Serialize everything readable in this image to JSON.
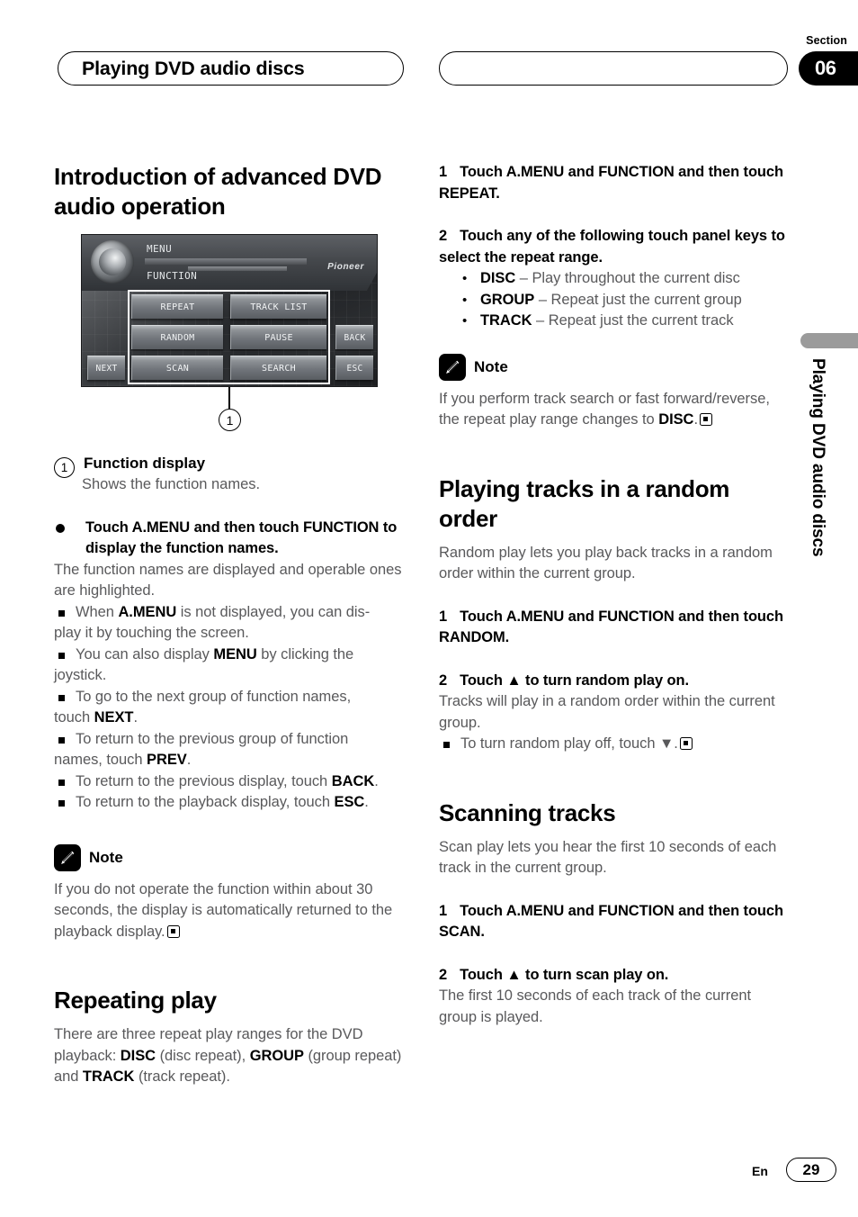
{
  "header": {
    "chapter_title": "Playing DVD audio discs",
    "section_label": "Section",
    "section_number": "06",
    "blank_pill": ""
  },
  "side_tab": {
    "vertical_title": "Playing DVD audio discs"
  },
  "left_column": {
    "heading": "Introduction of advanced DVD audio operation",
    "figure": {
      "device_menu_label": "MENU",
      "device_function_label": "FUNCTION",
      "device_brand": "Pioneer",
      "keys": [
        "REPEAT",
        "TRACK LIST",
        "RANDOM",
        "PAUSE",
        "SCAN",
        "SEARCH",
        "BACK",
        "ESC",
        "NEXT"
      ],
      "callout_number": "1"
    },
    "caption": {
      "number": "1",
      "title": "Function display",
      "subtitle": "Shows the function names."
    },
    "bullet_step": "Touch A.MENU and then touch FUNCTION to display the function names.",
    "bullet_step_body": "The function names are displayed and operable ones are highlighted.",
    "sub_items": [
      "When A.MENU is not displayed, you can display it by touching the screen.",
      "You can also display MENU by clicking the joystick.",
      "To go to the next group of function names, touch NEXT.",
      "To return to the previous group of function names, touch PREV.",
      "To return to the previous display, touch BACK.",
      "To return to the playback display, touch ESC."
    ],
    "note": {
      "label": "Note",
      "text": "If you do not operate the function within about 30 seconds, the display is automatically returned to the playback display."
    },
    "repeating_play": {
      "heading": "Repeating play",
      "body": "There are three repeat play ranges for the DVD playback: DISC (disc repeat), GROUP (group repeat) and TRACK (track repeat)."
    }
  },
  "right_column": {
    "repeat_steps": [
      {
        "num": "1",
        "text": "Touch A.MENU and FUNCTION and then touch REPEAT."
      },
      {
        "num": "2",
        "text": "Touch any of the following touch panel keys to select the repeat range."
      }
    ],
    "repeat_ranges": [
      {
        "key": "DISC",
        "desc": "– Play throughout the current disc"
      },
      {
        "key": "GROUP",
        "desc": "– Repeat just the current group"
      },
      {
        "key": "TRACK",
        "desc": "– Repeat just the current track"
      }
    ],
    "note": {
      "label": "Note",
      "text": "If you perform track search or fast forward/reverse, the repeat play range changes to DISC."
    },
    "random": {
      "heading": "Playing tracks in a random order",
      "body": "Random play lets you play back tracks in a random order within the current group.",
      "steps": [
        {
          "num": "1",
          "text": "Touch A.MENU and FUNCTION and then touch RANDOM."
        },
        {
          "num": "2",
          "text": "Touch ▲ to turn random play on."
        }
      ],
      "step2_body": "Tracks will play in a random order within the current group.",
      "sub_item": "To turn random play off, touch ▼."
    },
    "scanning": {
      "heading": "Scanning tracks",
      "body": "Scan play lets you hear the first 10 seconds of each track in the current group.",
      "steps": [
        {
          "num": "1",
          "text": "Touch A.MENU and FUNCTION and then touch SCAN."
        },
        {
          "num": "2",
          "text": "Touch ▲ to turn scan play on."
        }
      ],
      "step2_body": "The first 10 seconds of each track of the current group is played."
    }
  },
  "footer": {
    "language": "En",
    "page_number": "29"
  }
}
